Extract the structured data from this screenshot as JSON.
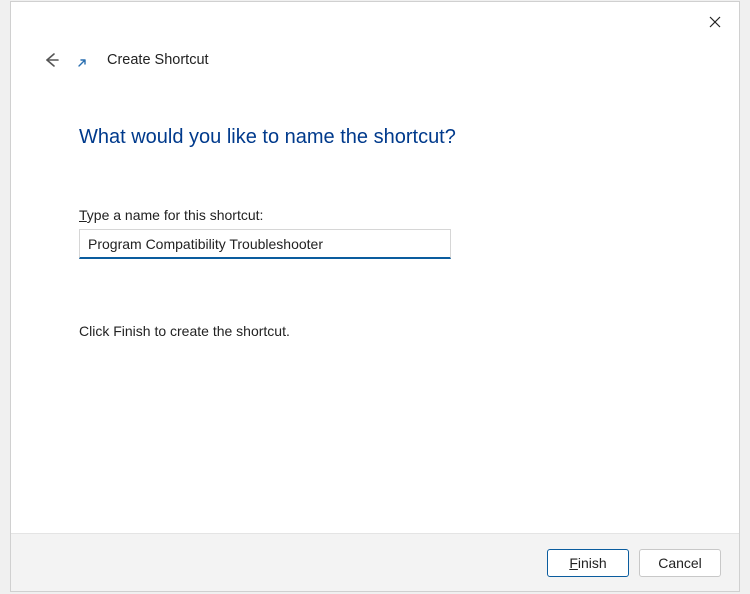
{
  "titlebar": {
    "close_aria": "Close"
  },
  "header": {
    "back_aria": "Back",
    "wizard_title": "Create Shortcut"
  },
  "content": {
    "heading": "What would you like to name the shortcut?",
    "field_label_prefix": "T",
    "field_label_rest": "ype a name for this shortcut:",
    "input_value": "Program Compatibility Troubleshooter",
    "help_text": "Click Finish to create the shortcut."
  },
  "footer": {
    "finish_prefix": "F",
    "finish_rest": "inish",
    "cancel_label": "Cancel"
  }
}
